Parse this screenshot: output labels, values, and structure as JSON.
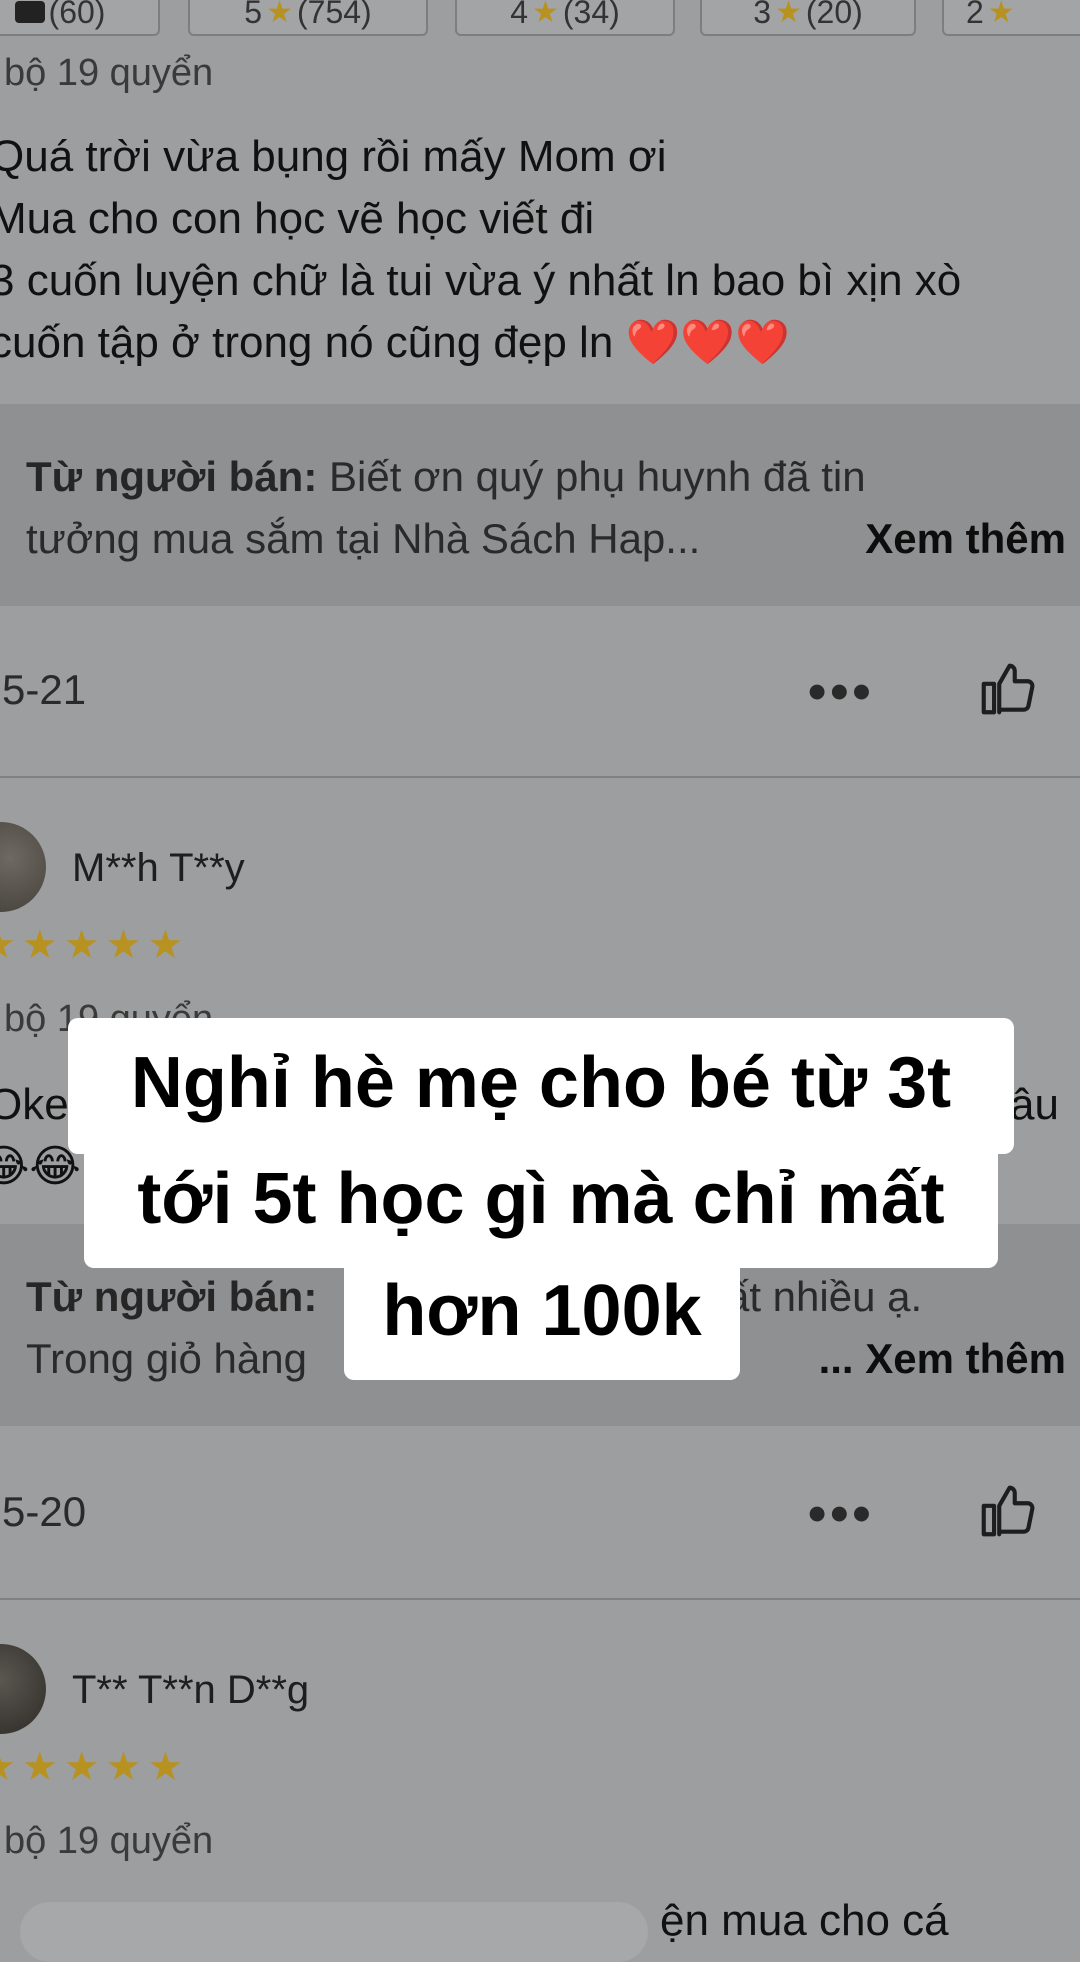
{
  "filter_chips": [
    {
      "prefix": "",
      "icon": "camera",
      "count": "(60)"
    },
    {
      "prefix": "5",
      "icon": "star",
      "count": "(754)"
    },
    {
      "prefix": "4",
      "icon": "star",
      "count": "(34)"
    },
    {
      "prefix": "3",
      "icon": "star",
      "count": "(20)"
    },
    {
      "prefix": "2",
      "icon": "star",
      "count": ""
    }
  ],
  "review1": {
    "variant": "bộ 19 quyển",
    "lines": [
      "Quá trời vừa bụng rồi mấy Mom ơi",
      "Mua cho con học vẽ học viết đi",
      "3 cuốn luyện chữ là tui vừa ý nhất ln bao bì xịn xò",
      "cuốn tập ở trong nó cũng đẹp ln "
    ],
    "hearts": "❤️❤️❤️",
    "seller_label": "Từ người bán:",
    "seller_line1": " Biết ơn quý phụ huynh đã tin",
    "seller_line2": "tưởng mua sắm tại Nhà Sách Hap...",
    "see_more": "Xem thêm",
    "date": "5-21"
  },
  "review2": {
    "username": "M**h T**y",
    "stars": "★★★★★",
    "variant": "bộ 19 quyển",
    "text_start": "Oke.",
    "text_end": "âu",
    "emoji": "😂😂",
    "seller_label": "Từ người bán:",
    "seller_line1_end": "rất nhiều ạ.",
    "seller_line2": "Trong giỏ hàng",
    "see_more": "... Xem thêm",
    "date": "5-20"
  },
  "review3": {
    "username": "T** T**n D**g",
    "stars": "★★★★★",
    "variant": "bộ 19 quyển",
    "text_partial": "ện mua cho cá"
  },
  "caption": {
    "line1": "Nghỉ hè mẹ cho bé  từ 3t",
    "line2": "tới 5t học gì mà chỉ mất",
    "line3": "hơn 100k"
  }
}
